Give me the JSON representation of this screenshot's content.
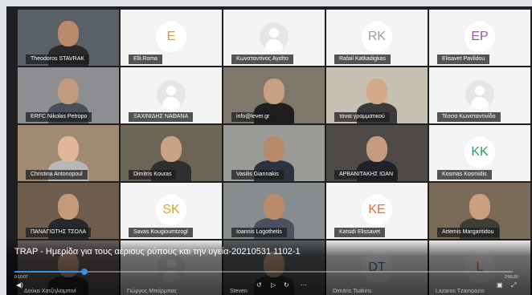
{
  "window_controls": {
    "minimize": "_",
    "close": "✕"
  },
  "tiles": [
    {
      "name": "Theodoros STAVRAK",
      "kind": "video",
      "bg": "#5a6068",
      "skin": "#b98a6c",
      "shirt": "#2a2a2a"
    },
    {
      "name": "Elli.Roma",
      "kind": "initials",
      "initials": "E",
      "color": "#e8922b"
    },
    {
      "name": "Κωνσταντίνος Αγαΐτο",
      "kind": "avatar"
    },
    {
      "name": "Rafail Katkadigkas",
      "kind": "initials",
      "initials": "RK",
      "color": "#9a9a9a"
    },
    {
      "name": "Elisavet Pavlidou",
      "kind": "initials",
      "initials": "EP",
      "color": "#9b4fb3"
    },
    {
      "name": "ERFC Nikolas Petropo",
      "kind": "video",
      "bg": "#8d8e91",
      "skin": "#c29a7d",
      "shirt": "#4a4f5a"
    },
    {
      "name": "ΞΑΧΙΝΙΔΗΣ ΝΑΘΑΝΑ",
      "kind": "avatar"
    },
    {
      "name": "info@lever.gr",
      "kind": "video",
      "bg": "#7f776c",
      "skin": "#c7a081",
      "shirt": "#1e1e1e"
    },
    {
      "name": "τανια γραμματικού",
      "kind": "video",
      "bg": "#c8c0b2",
      "skin": "#d2aa8a",
      "shirt": "#3a3a3a"
    },
    {
      "name": "Τέσσα Κωνσταντινίδο",
      "kind": "avatar"
    },
    {
      "name": "Christina Antonopoul",
      "kind": "video",
      "bg": "#a08a72",
      "skin": "#e0b79a",
      "shirt": "#b7b7b7"
    },
    {
      "name": "Dimitris Kouras",
      "kind": "video",
      "bg": "#6d6556",
      "skin": "#c9a386",
      "shirt": "#2f2f2f"
    },
    {
      "name": "Vasilis Giannakis",
      "kind": "video",
      "bg": "#9a9a96",
      "skin": "#b8896a",
      "shirt": "#2d3240"
    },
    {
      "name": "ΑΡΒΑΝΙΤΑΚΗΣ ΙΩΑΝ",
      "kind": "video",
      "bg": "#4d4a48",
      "skin": "#c59c7e",
      "shirt": "#1f2328"
    },
    {
      "name": "Kosmas Kosmidis",
      "kind": "initials",
      "initials": "KK",
      "color": "#2a9d5a"
    },
    {
      "name": "ΠΑΝΑΓΙΩΤΗΣ ΤΣΟΛΑ",
      "kind": "video",
      "bg": "#6e5c4c",
      "skin": "#c59a7a",
      "shirt": "#26292e"
    },
    {
      "name": "Savas Kougioumtzogl",
      "kind": "initials",
      "initials": "SK",
      "color": "#d9a520"
    },
    {
      "name": "Ioannis Logothetis",
      "kind": "video",
      "bg": "#878c8f",
      "skin": "#b98b6a",
      "shirt": "#4a5060"
    },
    {
      "name": "Katsidi Elissavet",
      "kind": "initials",
      "initials": "KE",
      "color": "#e56a3a"
    },
    {
      "name": "Artemis Margaritidou",
      "kind": "video",
      "bg": "#7a6a58",
      "skin": "#c99f80",
      "shirt": "#3c3f36"
    },
    {
      "name": "Δούκα Χατζηλιαμπινί",
      "kind": "video",
      "bg": "#6a6060",
      "skin": "#c9a086",
      "shirt": "#2a2a2a"
    },
    {
      "name": "Γιώργος Μπάρμπας",
      "kind": "avatar"
    },
    {
      "name": "Steven",
      "kind": "video",
      "bg": "#5a5f63",
      "skin": "#c29e82",
      "shirt": "#333"
    },
    {
      "name": "Dimitris Tsakiris",
      "kind": "initials",
      "initials": "DT",
      "color": "#3a7ea1"
    },
    {
      "name": "Lazaros Tzampazis",
      "kind": "initials",
      "initials": "L",
      "color": "#d3722b"
    }
  ],
  "player": {
    "title": "TRAP - Ημερίδα για τους αέριους ρύπους και την υγεία-20210531 1102-1",
    "time_current": "0:10:07",
    "time_total": "2:56:20",
    "progress": 0.14,
    "accent": "#3a8ee6",
    "icons": {
      "volume": "volume-icon",
      "rewind": "rewind-icon",
      "play": "play-icon",
      "forward": "forward-icon",
      "more": "more-icon",
      "pip": "pip-icon",
      "fullscreen": "fullscreen-icon"
    }
  }
}
